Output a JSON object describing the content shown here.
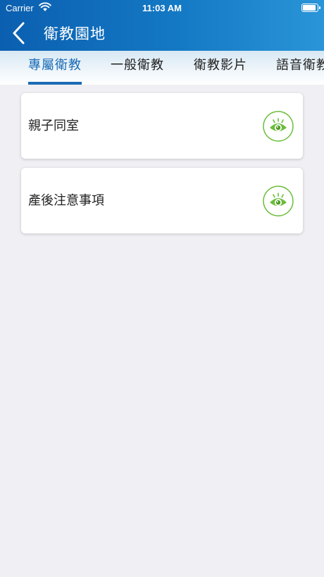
{
  "status_bar": {
    "carrier": "Carrier",
    "time": "11:03 AM"
  },
  "nav": {
    "title": "衛教園地"
  },
  "tabs": [
    {
      "label": "專屬衛教",
      "active": true
    },
    {
      "label": "一般衛教",
      "active": false
    },
    {
      "label": "衛教影片",
      "active": false
    },
    {
      "label": "語音衛教",
      "active": false
    }
  ],
  "items": [
    {
      "title": "親子同室",
      "icon": "eye-icon"
    },
    {
      "title": "產後注意事項",
      "icon": "eye-icon"
    }
  ],
  "colors": {
    "header_start": "#0b5fb0",
    "header_end": "#2a95d8",
    "tab_active": "#1a6bb5",
    "icon_green": "#6bbd3a",
    "background": "#efeff4"
  }
}
